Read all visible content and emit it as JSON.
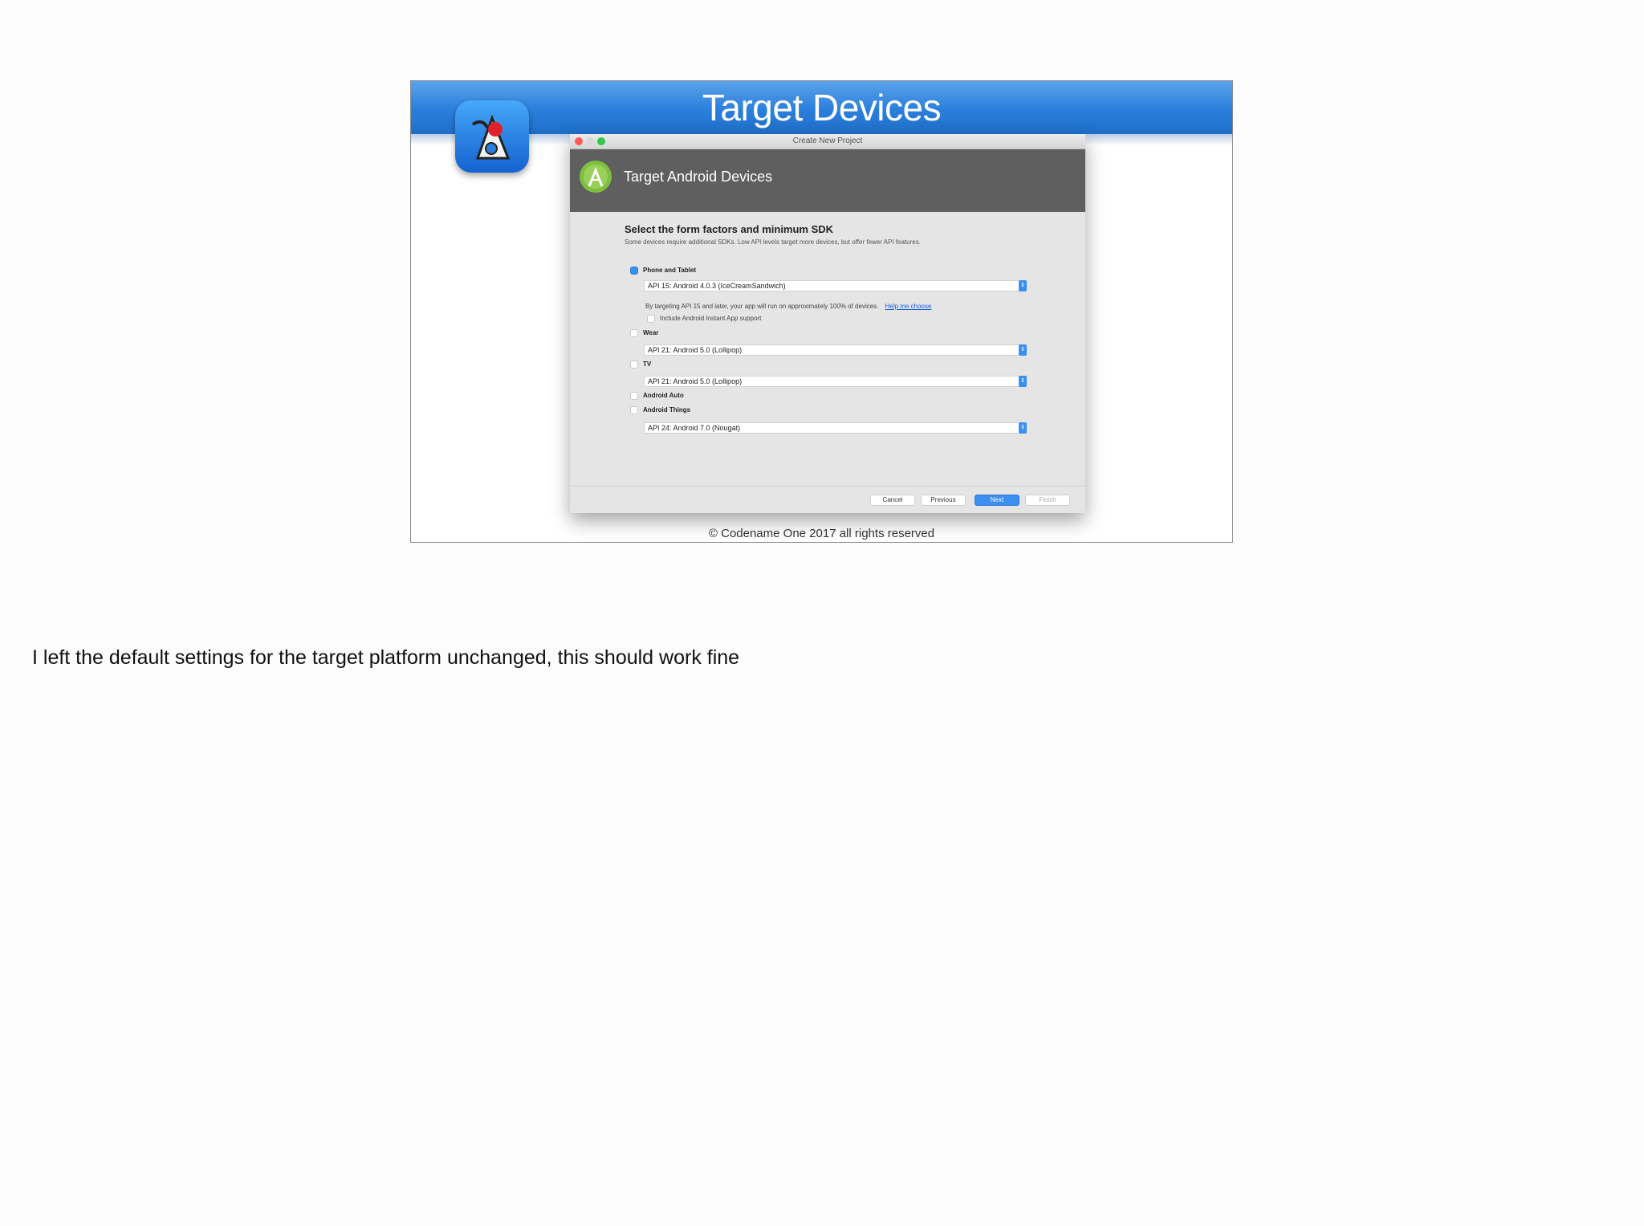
{
  "slide": {
    "title": "Target Devices",
    "footer": "© Codename One 2017 all rights reserved"
  },
  "dialog": {
    "window_title": "Create New Project",
    "header_title": "Target Android Devices",
    "heading": "Select the form factors and minimum SDK",
    "subheading": "Some devices require additional SDKs. Low API levels target more devices, but offer fewer API features.",
    "options": [
      {
        "label": "Phone and Tablet",
        "checked": true,
        "sdk": "API 15: Android 4.0.3 (IceCreamSandwich)"
      },
      {
        "label": "Wear",
        "checked": false,
        "sdk": "API 21: Android 5.0 (Lollipop)"
      },
      {
        "label": "TV",
        "checked": false,
        "sdk": "API 21: Android 5.0 (Lollipop)"
      },
      {
        "label": "Android Auto",
        "checked": false
      },
      {
        "label": "Android Things",
        "checked": false,
        "sdk": "API 24: Android 7.0 (Nougat)"
      }
    ],
    "note": "By targeting API 15 and later, your app will run on approximately 100% of devices.",
    "note_link": "Help me choose",
    "instant_app_label": "Include Android Instant App support",
    "buttons": {
      "cancel": "Cancel",
      "previous": "Previous",
      "next": "Next",
      "finish": "Finish"
    }
  },
  "caption": "I left the default settings for the target platform unchanged, this should work fine",
  "colors": {
    "header_blue": "#2b7fdc",
    "accent": "#3b8ff0"
  }
}
